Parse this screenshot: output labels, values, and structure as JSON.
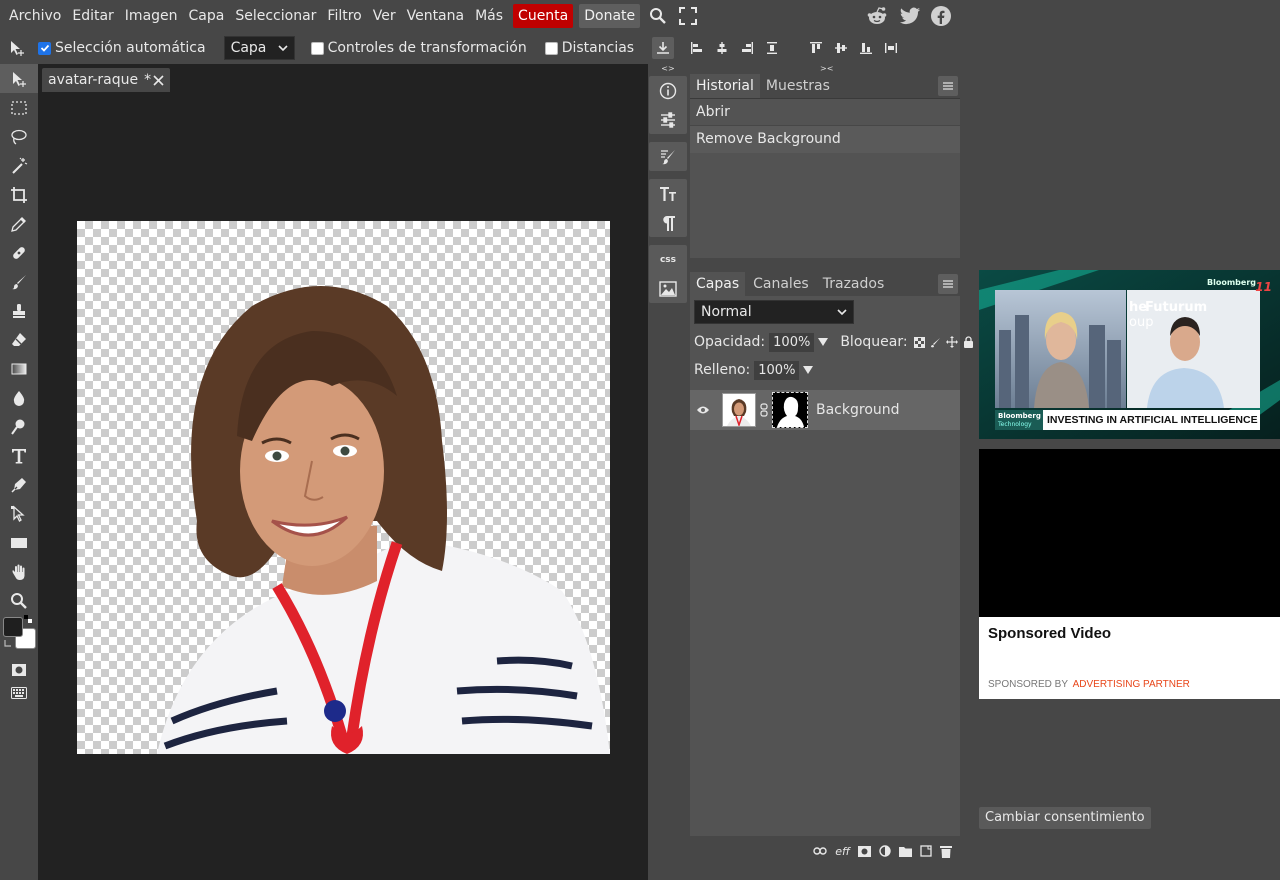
{
  "menu": {
    "items": [
      "Archivo",
      "Editar",
      "Imagen",
      "Capa",
      "Seleccionar",
      "Filtro",
      "Ver",
      "Ventana",
      "Más"
    ],
    "account": "Cuenta",
    "donate": "Donate"
  },
  "options": {
    "auto_select_label": "Selección automática",
    "auto_select_checked": true,
    "auto_select_target": "Capa",
    "transform_controls_label": "Controles de transformación",
    "distances_label": "Distancias"
  },
  "document": {
    "tab_title": "avatar-raque",
    "modified_marker": "*"
  },
  "icon_column": {
    "collapse_left": "<>",
    "collapse_right": "><",
    "css_label": "css"
  },
  "history_panel": {
    "tabs": [
      "Historial",
      "Muestras"
    ],
    "entries": [
      "Abrir",
      "Remove Background"
    ]
  },
  "layers_panel": {
    "tabs": [
      "Capas",
      "Canales",
      "Trazados"
    ],
    "blend_mode": "Normal",
    "opacity_label": "Opacidad:",
    "opacity_value": "100%",
    "lock_label": "Bloquear:",
    "fill_label": "Relleno:",
    "fill_value": "100%",
    "layers": [
      {
        "name": "Background"
      }
    ],
    "footer_eff_label": "eff"
  },
  "ad": {
    "channel_watermark": "Bloomberg",
    "channel_number": "11",
    "headline": "INVESTING IN ARTIFICIAL INTELLIGENCE",
    "tag_top": "Bloomberg",
    "tag_bottom": "Technology",
    "screen_text_1": "he",
    "screen_text_2": "Futurum",
    "screen_text_3": "oup",
    "card_title": "Sponsored Video",
    "sponsored_by": "SPONSORED BY",
    "partner": "ADVERTISING PARTNER"
  },
  "consent_button": "Cambiar consentimiento",
  "colors": {
    "ui_bg": "#474747",
    "workspace": "#222222",
    "account_red": "#c00000",
    "checkbox_blue": "#1e73e8",
    "partner_orange": "#e8461a"
  }
}
